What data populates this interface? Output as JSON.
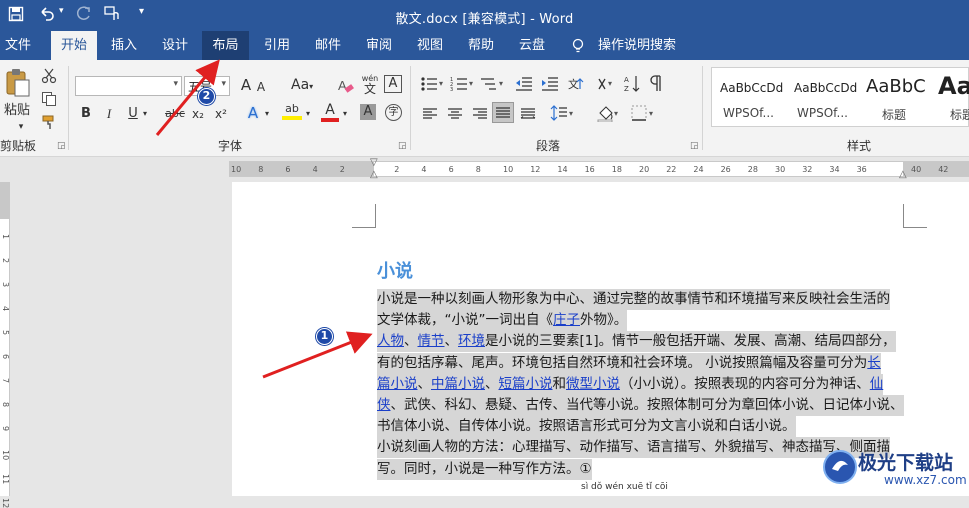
{
  "titlebar": {
    "title": "散文.docx [兼容模式] - Word",
    "save_icon": "save-icon",
    "undo_icon": "undo-icon",
    "redo_icon": "redo-icon",
    "touch_icon": "touch-mode-icon",
    "customize_icon": "customize-qat-icon"
  },
  "tabs": [
    {
      "label": "文件"
    },
    {
      "label": "开始"
    },
    {
      "label": "插入"
    },
    {
      "label": "设计"
    },
    {
      "label": "布局"
    },
    {
      "label": "引用"
    },
    {
      "label": "邮件"
    },
    {
      "label": "审阅"
    },
    {
      "label": "视图"
    },
    {
      "label": "帮助"
    },
    {
      "label": "云盘"
    },
    {
      "label": "操作说明搜索"
    }
  ],
  "ribbon": {
    "clipboard": {
      "paste_label": "粘贴",
      "group_label": "剪贴板"
    },
    "font": {
      "group_label": "字体",
      "font_name_value": "",
      "font_size_value": "五号",
      "grow_label": "A",
      "shrink_label": "A",
      "case_label": "Aa",
      "phonetic_label": "wén",
      "bold": "B",
      "italic": "I",
      "underline": "U",
      "strike": "abc",
      "subscript": "x₂",
      "superscript": "x²",
      "effects": "A",
      "highlight": "ab",
      "fontcolor": "A",
      "charshade": "A",
      "enclose": "字",
      "border_char": "A"
    },
    "paragraph": {
      "group_label": "段落"
    },
    "styles": {
      "group_label": "样式",
      "items": [
        {
          "preview": "AaBbCcDd",
          "name": "WPSOf..."
        },
        {
          "preview": "AaBbCcDd",
          "name": "WPSOf..."
        },
        {
          "preview": "AaBbC",
          "name": "标题"
        },
        {
          "preview": "Aa",
          "name": "标题"
        }
      ]
    }
  },
  "ruler": {
    "ticks": [
      "10",
      "8",
      "6",
      "4",
      "2",
      "",
      "2",
      "4",
      "6",
      "8",
      "10",
      "12",
      "14",
      "16",
      "18",
      "20",
      "22",
      "24",
      "26",
      "28",
      "30",
      "32",
      "34",
      "36",
      "",
      "40",
      "42"
    ]
  },
  "vruler": {
    "ticks": [
      "1",
      "2",
      "3",
      "4",
      "5",
      "6",
      "7",
      "8",
      "9",
      "10",
      "11",
      "12"
    ]
  },
  "document": {
    "heading": "小说",
    "lines": [
      {
        "segments": [
          {
            "t": "小说是一种以刻画人物形象为中心、通过完整的故事情节和环境描写来反映社会生活的"
          }
        ]
      },
      {
        "segments": [
          {
            "t": "文学体裁，“小说”一词出自《"
          },
          {
            "t": "庄子",
            "link": true
          },
          {
            "t": "外物》。"
          }
        ]
      },
      {
        "segments": [
          {
            "t": "人物",
            "link": true
          },
          {
            "t": "、"
          },
          {
            "t": "情节",
            "link": true
          },
          {
            "t": "、"
          },
          {
            "t": "环境",
            "link": true
          },
          {
            "t": "是小说的三要素[1]。情节一般包括开端、发展、高潮、结局四部分，"
          }
        ]
      },
      {
        "segments": [
          {
            "t": "有的包括序幕、尾声。环境包括自然环境和社会环境。 小说按照篇幅及容量可分为"
          },
          {
            "t": "长",
            "link": true
          }
        ]
      },
      {
        "segments": [
          {
            "t": "篇小说",
            "link": true
          },
          {
            "t": "、"
          },
          {
            "t": "中篇小说",
            "link": true
          },
          {
            "t": "、"
          },
          {
            "t": "短篇小说",
            "link": true
          },
          {
            "t": "和"
          },
          {
            "t": "微型小说",
            "link": true
          },
          {
            "t": "（小小说）。按照表现的内容可分为神话、"
          },
          {
            "t": "仙",
            "link": true
          }
        ]
      },
      {
        "segments": [
          {
            "t": "侠",
            "link": true
          },
          {
            "t": "、武侠、科幻、悬疑、古传、当代等小说。按照体制可分为章回体小说、日记体小说、"
          }
        ]
      },
      {
        "segments": [
          {
            "t": "书信体小说、自传体小说。按照语言形式可分为文言小说和白话小说。"
          }
        ]
      },
      {
        "segments": [
          {
            "t": "小说刻画人物的方法：心理描写、动作描写、语言描写、外貌描写、神态描写、侧面描"
          }
        ]
      },
      {
        "segments": [
          {
            "t": "写。同时，小说是一种写作方法。①"
          }
        ]
      }
    ],
    "partial_line": "sì  dǒ  wén  xuē  tǐ  cōi"
  },
  "annotations": [
    {
      "number": "1"
    },
    {
      "number": "2"
    }
  ],
  "watermark": {
    "name": "极光下载站",
    "url": "www.xz7.com"
  },
  "colors": {
    "title_bar": "#2b579a",
    "arrow": "#e02020",
    "badge": "#1f4aa8",
    "link": "#1a3fc9",
    "heading": "#4a90d9",
    "selection": "#d6d6d6"
  }
}
